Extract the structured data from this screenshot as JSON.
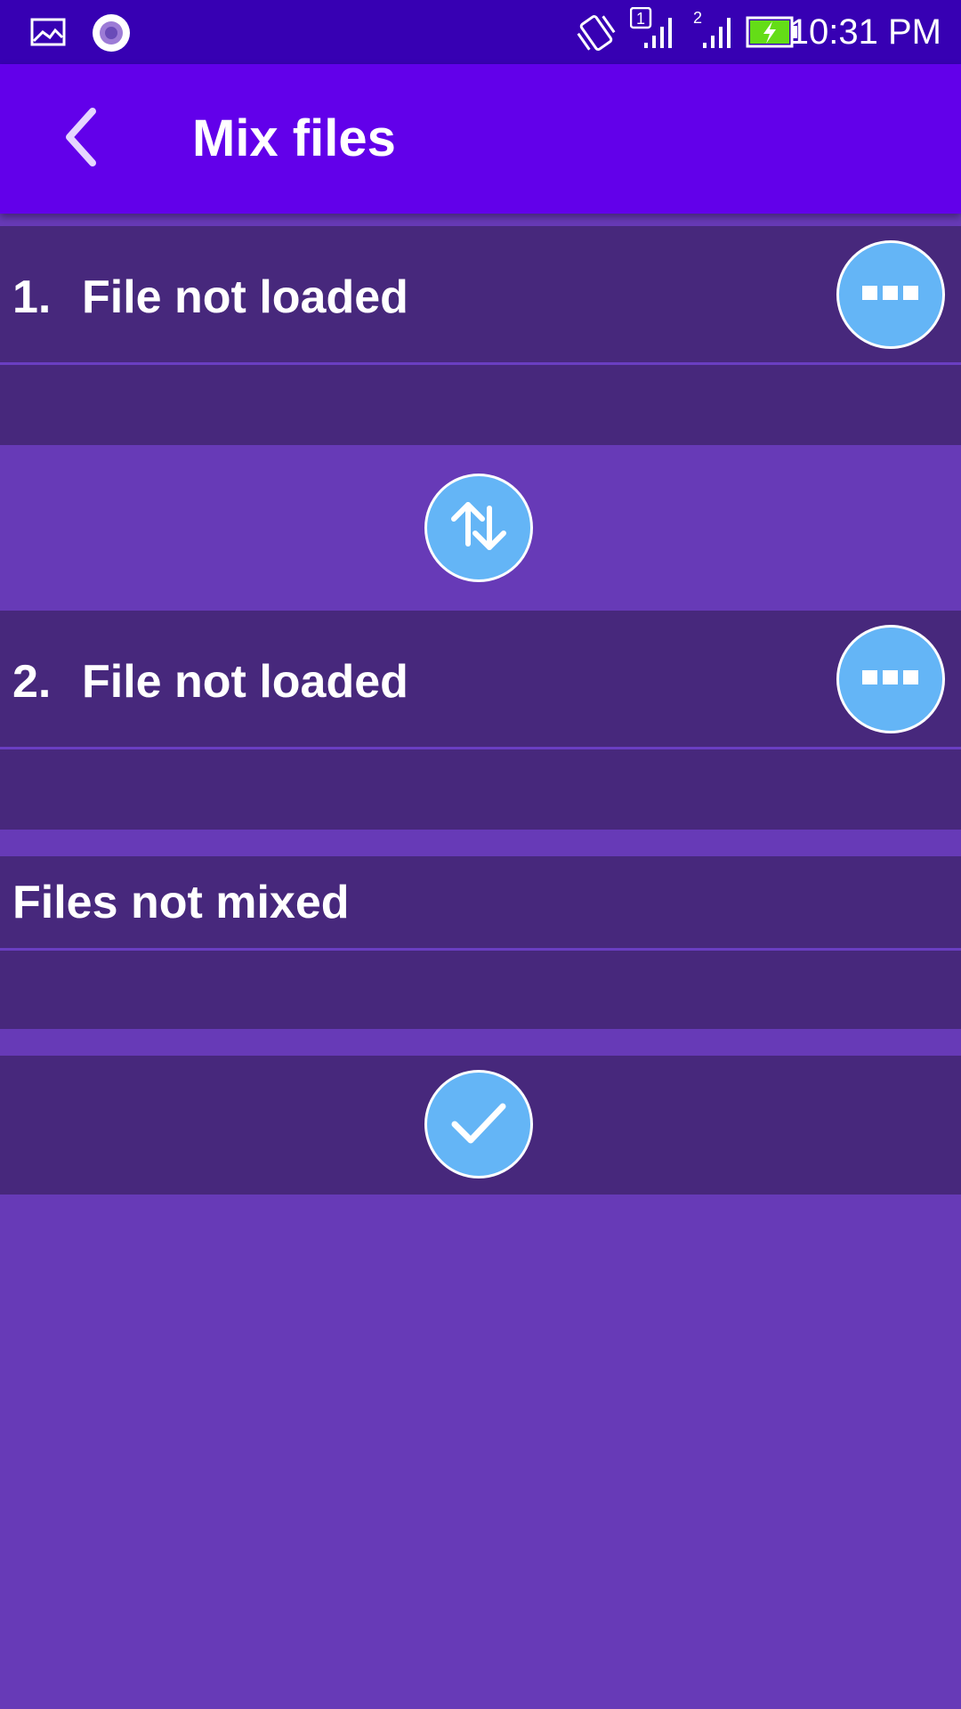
{
  "status_bar": {
    "time": "10:31 PM",
    "icons": [
      "gallery-icon",
      "record-icon",
      "vibrate-icon",
      "sim1-signal-icon",
      "sim2-signal-icon",
      "battery-charging-icon"
    ],
    "sim1_label": "1",
    "sim2_label": "2"
  },
  "app_bar": {
    "title": "Mix files",
    "back_icon": "chevron-left-icon"
  },
  "files": [
    {
      "number": "1.",
      "status": "File not loaded",
      "menu_icon": "more-options-icon"
    },
    {
      "number": "2.",
      "status": "File not loaded",
      "menu_icon": "more-options-icon"
    }
  ],
  "swap_button_icon": "swap-vertical-icon",
  "result": {
    "status": "Files not mixed"
  },
  "confirm_button_icon": "check-icon",
  "colors": {
    "status_bar": "#3700b3",
    "app_bar": "#6200ea",
    "background": "#673ab7",
    "card": "#47287c",
    "button": "#64b5f6",
    "battery": "#64dd17"
  }
}
